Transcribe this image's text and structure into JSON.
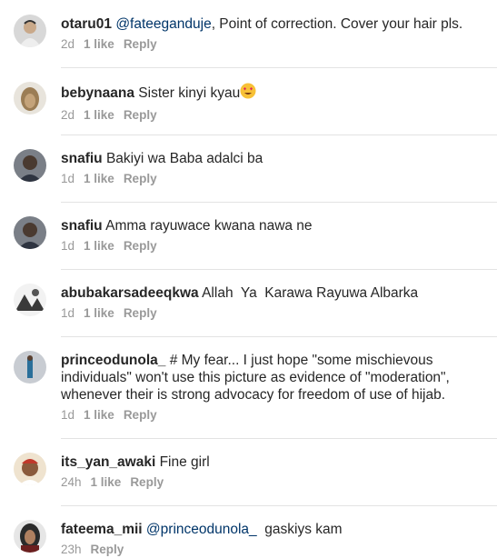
{
  "comments": [
    {
      "username": "otaru01",
      "mention": "@fateeganduje",
      "text": ", Point of correction. Cover your hair pls.",
      "time": "2d",
      "likes": "1 like",
      "reply": "Reply",
      "avatar": "avatar-1"
    },
    {
      "username": "bebynaana",
      "mention": "",
      "text": " Sister kinyi kyau",
      "emoji": "heart-eyes-emoji",
      "time": "2d",
      "likes": "1 like",
      "reply": "Reply",
      "avatar": "avatar-2"
    },
    {
      "username": "snafiu",
      "mention": "",
      "text": " Bakiyi wa Baba adalci ba",
      "time": "1d",
      "likes": "1 like",
      "reply": "Reply",
      "avatar": "avatar-3"
    },
    {
      "username": "snafiu",
      "mention": "",
      "text": " Amma rayuwace kwana nawa ne",
      "time": "1d",
      "likes": "1 like",
      "reply": "Reply",
      "avatar": "avatar-4"
    },
    {
      "username": "abubakarsadeeqkwa",
      "mention": "",
      "text": " Allah  Ya  Karawa Rayuwa Albarka",
      "time": "1d",
      "likes": "1 like",
      "reply": "Reply",
      "avatar": "avatar-5"
    },
    {
      "username": "princeodunola_",
      "mention": "",
      "text": " # My fear... I just hope \"some mischievous individuals\" won't use this picture as evidence of \"moderation\", whenever their is strong advocacy for freedom of use of hijab.",
      "time": "1d",
      "likes": "1 like",
      "reply": "Reply",
      "avatar": "avatar-6"
    },
    {
      "username": "its_yan_awaki",
      "mention": "",
      "text": " Fine girl",
      "time": "24h",
      "likes": "1 like",
      "reply": "Reply",
      "avatar": "avatar-7"
    },
    {
      "username": "fateema_mii",
      "mention": "@princeodunola_",
      "text": "  gaskiys kam",
      "time": "23h",
      "likes": "",
      "reply": "Reply",
      "avatar": "avatar-8"
    }
  ],
  "colors": {
    "text": "#262626",
    "meta": "#999999",
    "mention": "#003569",
    "separator": "#e3e3e3"
  }
}
